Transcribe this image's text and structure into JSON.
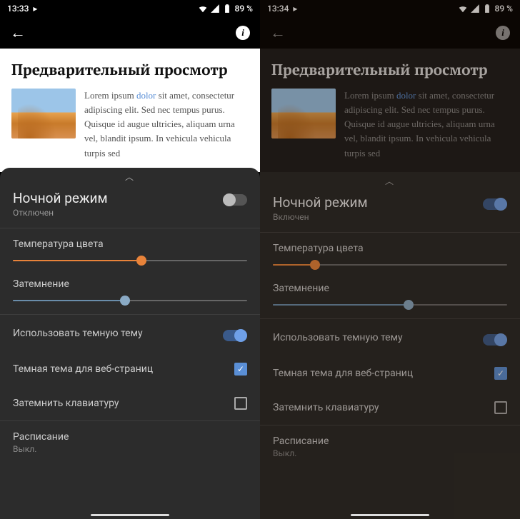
{
  "left": {
    "status": {
      "time": "13:33",
      "battery": "89 %"
    },
    "preview": {
      "title": "Предварительный просмотр",
      "text_pre": "Lorem ipsum ",
      "link": "dolor",
      "text_post": " sit amet, consectetur adipiscing elit. Sed nec tempus purus. Quisque id augue ultricies, aliquam urna vel, blandit ipsum. In vehicula vehicula turpis sed"
    },
    "sheet": {
      "title": "Ночной режим",
      "subtitle": "Отключен",
      "main_toggle": "off",
      "color_temp": {
        "label": "Температура цвета",
        "value": 55
      },
      "dim": {
        "label": "Затемнение",
        "value": 48
      },
      "dark_theme": {
        "label": "Использовать темную тему",
        "toggle": "on"
      },
      "dark_web": {
        "label": "Темная тема для веб-страниц",
        "checked": true
      },
      "dim_keyboard": {
        "label": "Затемнить клавиатуру",
        "checked": false
      },
      "schedule": {
        "label": "Расписание",
        "value": "Выкл."
      }
    }
  },
  "right": {
    "status": {
      "time": "13:34",
      "battery": "89 %"
    },
    "preview": {
      "title": "Предварительный просмотр",
      "text_pre": "Lorem ipsum ",
      "link": "dolor",
      "text_post": " sit amet, consectetur adipiscing elit. Sed nec tempus purus. Quisque id augue ultricies, aliquam urna vel, blandit ipsum. In vehicula vehicula turpis sed"
    },
    "sheet": {
      "title": "Ночной режим",
      "subtitle": "Включен",
      "main_toggle": "on",
      "color_temp": {
        "label": "Температура цвета",
        "value": 18
      },
      "dim": {
        "label": "Затемнение",
        "value": 58
      },
      "dark_theme": {
        "label": "Использовать темную тему",
        "toggle": "on"
      },
      "dark_web": {
        "label": "Темная тема для веб-страниц",
        "checked": true
      },
      "dim_keyboard": {
        "label": "Затемнить клавиатуру",
        "checked": false
      },
      "schedule": {
        "label": "Расписание",
        "value": "Выкл."
      }
    }
  }
}
